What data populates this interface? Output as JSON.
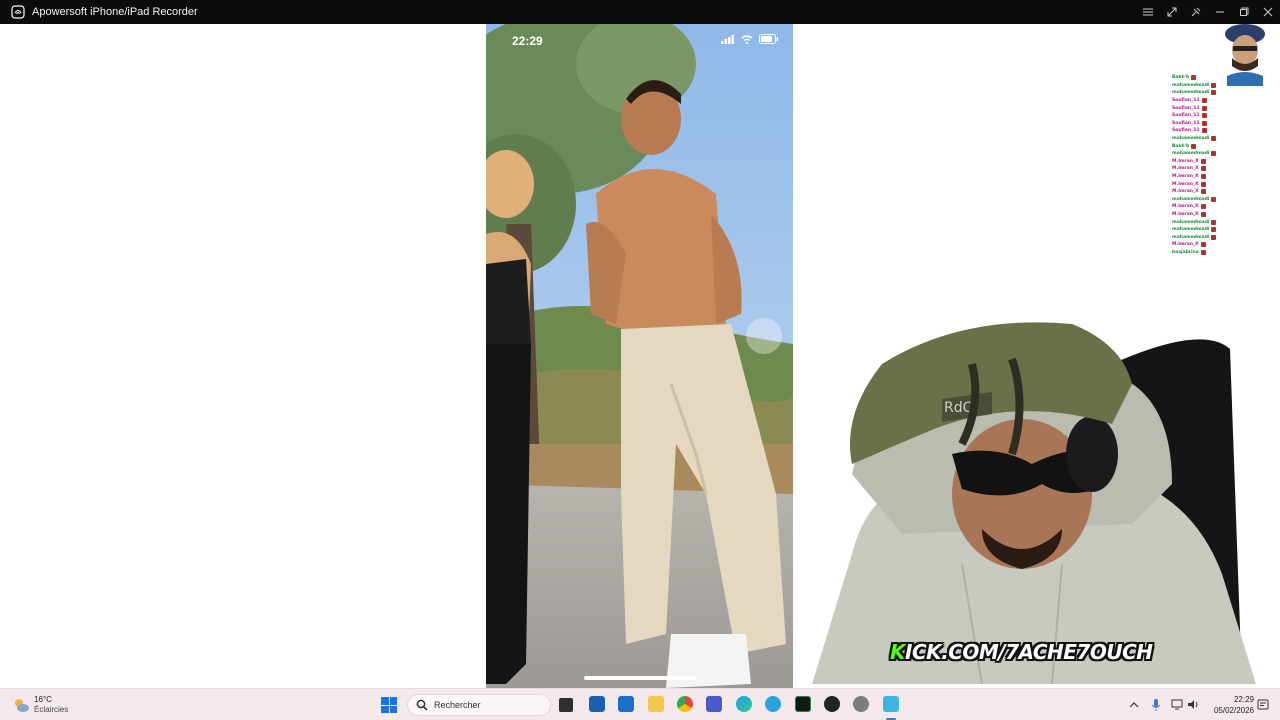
{
  "window": {
    "title": "Apowersoft iPhone/iPad Recorder"
  },
  "phone": {
    "time": "22:29"
  },
  "chat": {
    "lines": [
      {
        "user": "Bakh'b",
        "color": "#1a8a3a"
      },
      {
        "user": "mohamedmadi",
        "color": "#1a8a3a"
      },
      {
        "user": "mohamedmadi",
        "color": "#1a8a3a"
      },
      {
        "user": "Soufian_11",
        "color": "#b3168a"
      },
      {
        "user": "Soufian_11",
        "color": "#b3168a"
      },
      {
        "user": "Soufian_11",
        "color": "#b3168a"
      },
      {
        "user": "Soufian_11",
        "color": "#b3168a"
      },
      {
        "user": "Soufian_11",
        "color": "#b3168a"
      },
      {
        "user": "mohamedmadi",
        "color": "#1a8a3a"
      },
      {
        "user": "Bakh'b",
        "color": "#1a8a3a"
      },
      {
        "user": "mohamedmadi",
        "color": "#1a8a3a"
      },
      {
        "user": "M.Imran_X",
        "color": "#b3168a"
      },
      {
        "user": "M.Imran_X",
        "color": "#b3168a"
      },
      {
        "user": "M.Imran_X",
        "color": "#b3168a"
      },
      {
        "user": "M.Imran_X",
        "color": "#b3168a"
      },
      {
        "user": "M.Imran_X",
        "color": "#b3168a"
      },
      {
        "user": "mohamedmadi",
        "color": "#1a8a3a"
      },
      {
        "user": "M.Imran_X",
        "color": "#b3168a"
      },
      {
        "user": "M.Imran_X",
        "color": "#b3168a"
      },
      {
        "user": "mohamedmadi",
        "color": "#1a8a3a"
      },
      {
        "user": "mohamedmadi",
        "color": "#1a8a3a"
      },
      {
        "user": "mohamedmadi",
        "color": "#1a8a3a"
      },
      {
        "user": "M.Imran_X",
        "color": "#b3168a"
      },
      {
        "user": "bosjabrina",
        "color": "#1a8a3a"
      }
    ]
  },
  "stream": {
    "banner_k": "K",
    "banner_rest": "ICK.COM/7ACHE7OUCH"
  },
  "taskbar": {
    "weather": {
      "temp": "16°C",
      "desc": "Éclaircies"
    },
    "search_placeholder": "Rechercher",
    "clock": {
      "time": "22:29",
      "date": "05/02/2026"
    }
  },
  "icons": {
    "app": "recorder-icon",
    "weather": "partly-cloudy-icon",
    "start": "windows-start-icon",
    "search": "search-icon"
  }
}
